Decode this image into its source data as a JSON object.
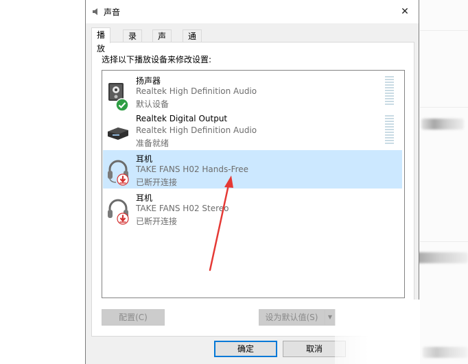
{
  "window": {
    "title": "声音",
    "close_glyph": "✕"
  },
  "tabs": [
    {
      "label": "播放",
      "active": true
    },
    {
      "label": "录制",
      "active": false
    },
    {
      "label": "声音",
      "active": false
    },
    {
      "label": "通信",
      "active": false
    }
  ],
  "instruction": "选择以下播放设备来修改设置:",
  "devices": [
    {
      "name": "扬声器",
      "description": "Realtek High Definition Audio",
      "status": "默认设备",
      "icon": "speaker-icon",
      "badge": "default-check-icon",
      "selected": false
    },
    {
      "name": "Realtek Digital Output",
      "description": "Realtek High Definition Audio",
      "status": "准备就绪",
      "icon": "digital-output-icon",
      "badge": "",
      "selected": false
    },
    {
      "name": "耳机",
      "description": "TAKE FANS H02 Hands-Free",
      "status": "已断开连接",
      "icon": "headset-icon",
      "badge": "disconnected-arrow-icon",
      "selected": true
    },
    {
      "name": "耳机",
      "description": "TAKE FANS H02 Stereo",
      "status": "已断开连接",
      "icon": "headset-icon",
      "badge": "disconnected-arrow-icon",
      "selected": false
    }
  ],
  "buttons": {
    "configure": "配置(C)",
    "set_default": "设为默认值(S)",
    "set_default_dropdown": "▼",
    "ok": "确定",
    "cancel": "取消"
  },
  "colors": {
    "selection": "#cce8ff",
    "accent": "#0078d7",
    "annotation_arrow": "#e53935",
    "default_badge": "#2e9e44",
    "disconnected_badge": "#d32f2f"
  }
}
